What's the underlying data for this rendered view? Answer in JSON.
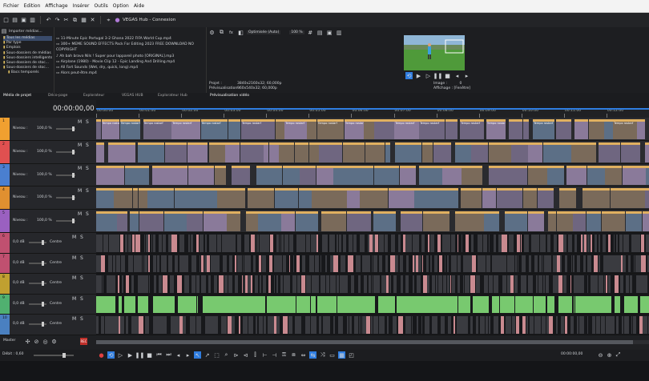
{
  "menu": [
    "Fichier",
    "Edition",
    "Affichage",
    "Insérer",
    "Outils",
    "Option",
    "Aide"
  ],
  "window_title": "VEGAS Hub - Connexion",
  "explorer": {
    "import_label": "Importer médias...",
    "tree": [
      "Tous les médias",
      "Par type",
      "Emplois",
      "Sous-dossiers de médias",
      "Sous-dossiers intelligents",
      "Sous-dossiers de stoc...",
      "Sous-dossiers de stoc...",
      "Bacs temporels"
    ],
    "files": [
      "11-Minute Epic Portugal 3-2 Ghana  2022 FIFA World Cup.mp4",
      "300+ MEME SOUND EFFECTS Pack For Editing 2023  FREE DOWNLOAD NO COPYRIGHT",
      "Ah bah bravo Nils ! Super pour lappareil photo [ORIGINAL].mp3",
      "Airplane (1980) - Movie Clip 12 - Epic Landing And Drilling.mp4",
      "All Fart Sounds (Wet, dry, quick, long).mp4",
      "Alors peut-être.mp4"
    ]
  },
  "preview": {
    "quality_label": "Optimisée (Auto)",
    "zoom": "100 %",
    "projet_label": "Projet :",
    "projet_value": "3840x2160x32; 60,000p",
    "previs_label": "Prévisualisation :",
    "previs_value": "960x540x32; 60,000p",
    "image_label": "Image :",
    "image_value": "0",
    "affichage_label": "Affichage :",
    "affichage_value": "[Fenêtre]"
  },
  "tabs": [
    "Média de projet",
    "Déco-page",
    "Explorateur",
    "VEGAS HUB",
    "Explorateur Hub",
    "Prévisualisation vidéo"
  ],
  "timecode": "00:00:00,00",
  "ruler_ticks": [
    "00:00:00",
    "00:01:00",
    "00:02:00",
    "00:03:00",
    "00:04:00",
    "00:05:00",
    "00:06:00",
    "00:07:00",
    "00:08:00",
    "00:09:00",
    "00:10:00",
    "00:11:00",
    "00:12:00",
    "00:13:00"
  ],
  "clip_label": "Tempo rostarf",
  "video_tracks": [
    {
      "num": "1",
      "level_label": "Niveau :",
      "level": "100,0 %",
      "color": "#f0a030"
    },
    {
      "num": "2",
      "level_label": "Niveau :",
      "level": "100,0 %",
      "color": "#e05050"
    },
    {
      "num": "3",
      "level_label": "Niveau :",
      "level": "100,0 %",
      "color": "#4a7fd0"
    },
    {
      "num": "4",
      "level_label": "Niveau :",
      "level": "100,0 %",
      "color": "#e09030"
    },
    {
      "num": "5",
      "level_label": "Niveau :",
      "level": "100,0 %",
      "color": "#9a60c0"
    }
  ],
  "audio_tracks": [
    {
      "num": "6",
      "vol": "0,0 dB",
      "pan": "Centre",
      "color": "#c05070"
    },
    {
      "num": "7",
      "vol": "0,0 dB",
      "pan": "Centre",
      "color": "#c05070"
    },
    {
      "num": "8",
      "vol": "0,0 dB",
      "pan": "Centre",
      "color": "#c0a030"
    },
    {
      "num": "9",
      "vol": "0,0 dB",
      "pan": "Centre",
      "color": "#50b070"
    },
    {
      "num": "10",
      "vol": "0,0 dB",
      "pan": "Centre",
      "color": "#4a80c0"
    }
  ],
  "mute": "M",
  "solo": "S",
  "master_label": "Master",
  "rate_label": "Débit : 0,60",
  "status_timecode": "00:00:00,00",
  "colors": {
    "accent": "#2f7de0",
    "video_clip": "#7a6f8a",
    "audio_clip": "#6fcf6a"
  }
}
